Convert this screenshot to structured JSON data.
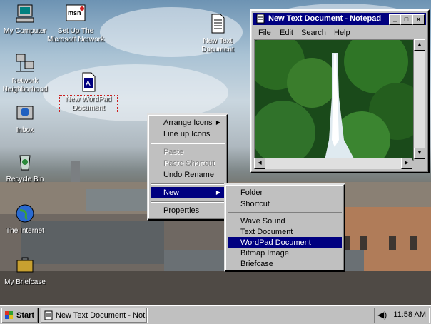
{
  "desktop": {
    "icons": [
      {
        "label": "My Computer"
      },
      {
        "label": "Set Up The Microsoft Network"
      },
      {
        "label": "New Text Document"
      },
      {
        "label": "Network Neighborhood"
      },
      {
        "label": "New WordPad Document"
      },
      {
        "label": "Inbox"
      },
      {
        "label": "Recycle Bin"
      },
      {
        "label": "The Internet"
      },
      {
        "label": "My Briefcase"
      }
    ]
  },
  "notepad": {
    "title": "New Text Document - Notepad",
    "menu": [
      "File",
      "Edit",
      "Search",
      "Help"
    ],
    "controls": {
      "minimize": "_",
      "maximize": "□",
      "close": "×"
    }
  },
  "context_menu": {
    "items": [
      {
        "label": "Arrange Icons",
        "submenu": true
      },
      {
        "label": "Line up Icons"
      },
      {
        "label": "Paste",
        "disabled": true
      },
      {
        "label": "Paste Shortcut",
        "disabled": true
      },
      {
        "label": "Undo Rename"
      },
      {
        "label": "New",
        "submenu": true,
        "highlighted": true
      },
      {
        "label": "Properties"
      }
    ]
  },
  "new_submenu": {
    "items": [
      {
        "label": "Folder"
      },
      {
        "label": "Shortcut"
      },
      {
        "label": "Wave Sound"
      },
      {
        "label": "Text Document"
      },
      {
        "label": "WordPad Document",
        "highlighted": true
      },
      {
        "label": "Bitmap Image"
      },
      {
        "label": "Briefcase"
      }
    ]
  },
  "taskbar": {
    "start_label": "Start",
    "task_label": "New Text Document - Not...",
    "clock": "11:58 AM"
  },
  "colors": {
    "selection": "#000080",
    "face": "#c0c0c0",
    "title": "#000080"
  }
}
